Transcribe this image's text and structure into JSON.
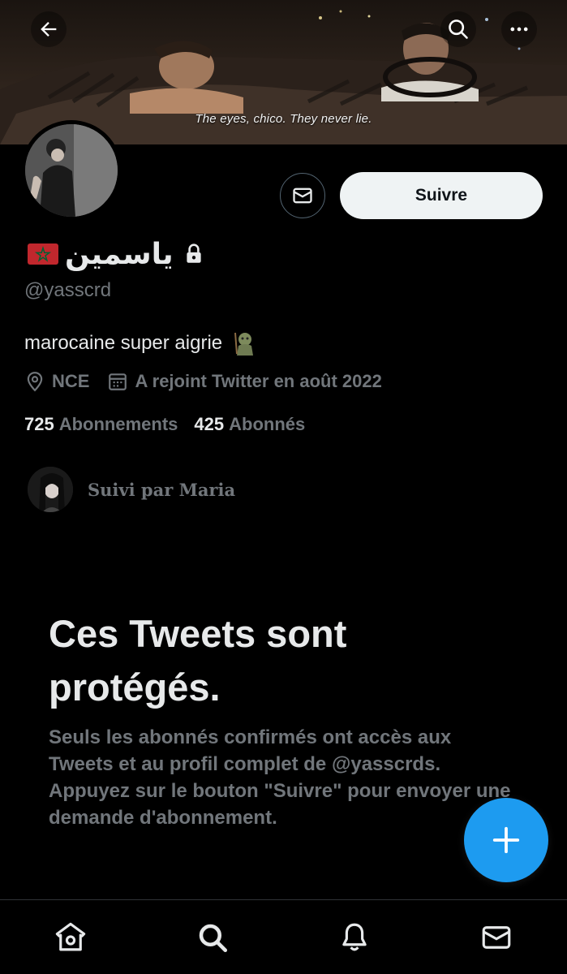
{
  "header": {
    "back_icon": "arrow-left-icon",
    "search_icon": "search-icon",
    "more_icon": "more-horizontal-icon",
    "banner_subtitle": "The eyes, chico. They never lie."
  },
  "profile": {
    "display_name": "ياسمين",
    "flag": "morocco-flag",
    "locked": true,
    "handle": "@yasscrd",
    "bio": "marocaine super aigrie",
    "bio_emoji": "troll-emoji",
    "location": "NCE",
    "joined": "A rejoint Twitter en août 2022",
    "following_count": "725",
    "following_label": "Abonnements",
    "followers_count": "425",
    "followers_label": "Abonnés",
    "followed_by": "Suivi par Maria"
  },
  "actions": {
    "message_icon": "envelope-icon",
    "follow_label": "Suivre"
  },
  "protected": {
    "title": "Ces Tweets sont protégés.",
    "description": "Seuls les abonnés confirmés ont accès aux Tweets et au profil complet de @yasscrds. Appuyez sur le bouton \"Suivre\" pour envoyer une demande d'abonnement."
  },
  "fab": {
    "icon": "plus-icon"
  },
  "bottom_nav": {
    "items": [
      "home-icon",
      "search-icon",
      "bell-icon",
      "envelope-icon"
    ]
  },
  "colors": {
    "background": "#000000",
    "primary_text": "#e7e9ea",
    "secondary_text": "#71767b",
    "accent": "#1d9bf0",
    "follow_button_bg": "#eff3f4",
    "flag_red": "#c1272d",
    "flag_green": "#006233"
  }
}
